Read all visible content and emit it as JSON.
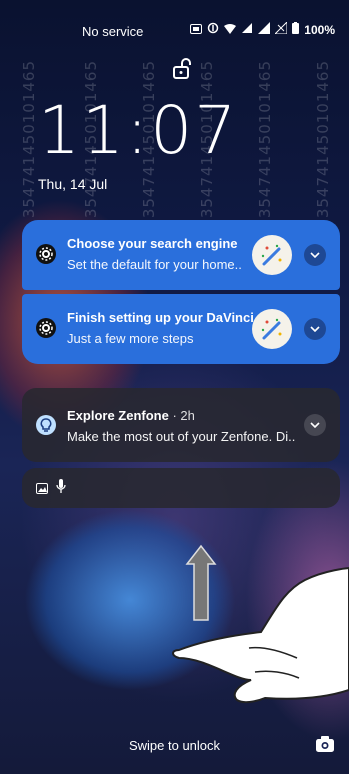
{
  "status_bar": {
    "carrier": "No service",
    "battery": "100%",
    "icons": [
      "screen-record-icon",
      "data-saver-icon",
      "wifi-icon",
      "hotspot-icon",
      "signal-icon",
      "no-signal-icon",
      "battery-icon"
    ]
  },
  "lockscreen": {
    "time": "11:07",
    "date": "Thu, 14 Jul",
    "watermark": "354741450101465",
    "swipe_hint": "Swipe to unlock"
  },
  "notifications": [
    {
      "icon": "gear-icon",
      "title": "Choose your search engine",
      "body": "Set the default for your home..",
      "accent": "#2a6fdc"
    },
    {
      "icon": "gear-icon",
      "title": "Finish setting up your DaVinci",
      "body": "Just a few more steps",
      "accent": "#2a6fdc"
    },
    {
      "icon": "bulb-icon",
      "title": "Explore Zenfone",
      "time": "· 2h",
      "body": "Make the most out of your Zenfone. Di.."
    }
  ],
  "media_strip": {
    "icons": [
      "image-icon",
      "microphone-icon"
    ]
  },
  "colors": {
    "notification_blue": "#2a6fdc",
    "notification_dark": "#28282f"
  }
}
